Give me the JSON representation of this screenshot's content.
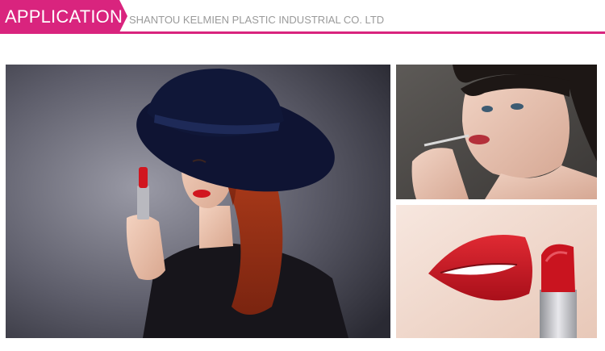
{
  "header": {
    "section_label": "APPLICATION",
    "company_name": "SHANTOU KELMIEN PLASTIC INDUSTRIAL CO. LTD"
  },
  "colors": {
    "accent": "#d9247e",
    "company_text": "#9a9a9a",
    "lipstick_red": "#d1161f"
  },
  "photos": [
    {
      "name": "woman-in-hat-holding-lipstick"
    },
    {
      "name": "woman-applying-lipstick"
    },
    {
      "name": "red-lips-with-lipstick"
    }
  ]
}
